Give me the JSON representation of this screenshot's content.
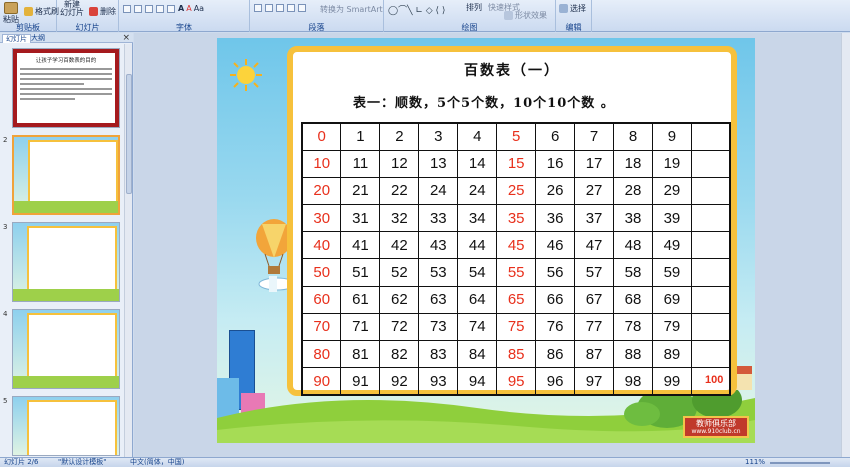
{
  "ribbon": {
    "clipboard": {
      "paste": "粘贴",
      "format_painter": "格式刷",
      "group": "剪贴板"
    },
    "slides": {
      "new_slide_line1": "新建",
      "new_slide_line2": "幻灯片",
      "delete": "删除",
      "group": "幻灯片"
    },
    "font": {
      "group": "字体",
      "font_size_a": "A",
      "font_size_a2": "A",
      "aa": "Aa"
    },
    "paragraph": {
      "group": "段落",
      "smartart": "转换为 SmartArt"
    },
    "drawing": {
      "group": "绘图",
      "arrange": "排列",
      "quick_styles": "快速样式",
      "shape_effects": "形状效果"
    },
    "editing": {
      "group": "编辑",
      "select": "选择"
    }
  },
  "leftpane": {
    "tab_slides": "幻灯片",
    "tab_outline": "大纲",
    "close": "×",
    "thumb_numbers": [
      "",
      "2",
      "3",
      "4",
      "5"
    ],
    "thumb1_title": "让孩子学习百数表的目的"
  },
  "slide": {
    "title": "百数表（一）",
    "subtitle": "表一：顺数，5个5个数，10个10个数 。",
    "rows": [
      [
        "0",
        "1",
        "2",
        "3",
        "4",
        "5",
        "6",
        "7",
        "8",
        "9",
        ""
      ],
      [
        "10",
        "11",
        "12",
        "13",
        "14",
        "15",
        "16",
        "17",
        "18",
        "19",
        ""
      ],
      [
        "20",
        "21",
        "22",
        "24",
        "24",
        "25",
        "26",
        "27",
        "28",
        "29",
        ""
      ],
      [
        "30",
        "31",
        "32",
        "33",
        "34",
        "35",
        "36",
        "37",
        "38",
        "39",
        ""
      ],
      [
        "40",
        "41",
        "42",
        "43",
        "44",
        "45",
        "46",
        "47",
        "48",
        "49",
        ""
      ],
      [
        "50",
        "51",
        "52",
        "53",
        "54",
        "55",
        "56",
        "57",
        "58",
        "59",
        ""
      ],
      [
        "60",
        "61",
        "62",
        "63",
        "64",
        "65",
        "66",
        "67",
        "68",
        "69",
        ""
      ],
      [
        "70",
        "71",
        "72",
        "73",
        "74",
        "75",
        "76",
        "77",
        "78",
        "79",
        ""
      ],
      [
        "80",
        "81",
        "82",
        "83",
        "84",
        "85",
        "86",
        "87",
        "88",
        "89",
        ""
      ],
      [
        "90",
        "91",
        "92",
        "93",
        "94",
        "95",
        "96",
        "97",
        "98",
        "99",
        ""
      ]
    ],
    "hundred": "100",
    "logo_line1": "教师俱乐部",
    "logo_line2": "www.910club.cn",
    "colors": {
      "red": "#e8301c",
      "frame": "#f6c13c",
      "sky": "#6fc6ea"
    }
  },
  "status": {
    "slide_info": "幻灯片 2/6",
    "theme": "\"默认设计模板\"",
    "language": "中文(简体，中国)",
    "zoom": "111%"
  }
}
